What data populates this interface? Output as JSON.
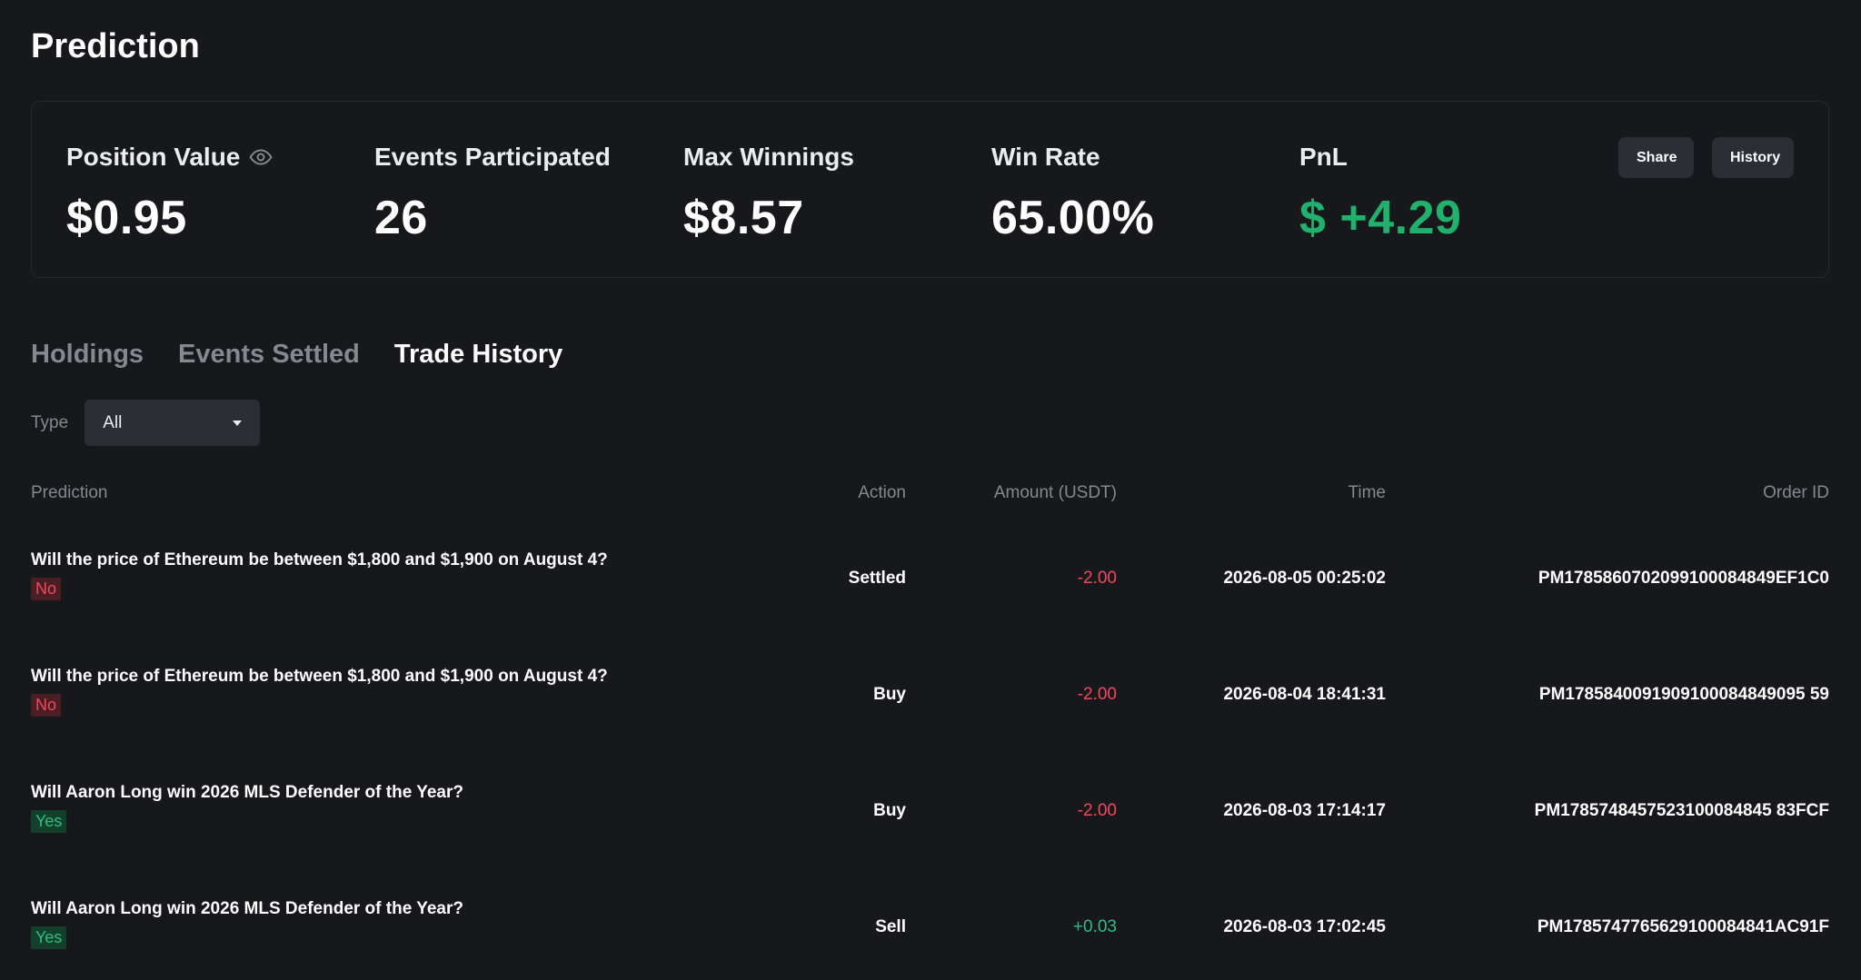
{
  "page": {
    "title": "Prediction"
  },
  "summary": {
    "position_value_label": "Position Value",
    "position_value": "$0.95",
    "events_participated_label": "Events Participated",
    "events_participated": "26",
    "max_winnings_label": "Max Winnings",
    "max_winnings": "$8.57",
    "win_rate_label": "Win Rate",
    "win_rate": "65.00%",
    "pnl_label": "PnL",
    "pnl": "$ +4.29",
    "share_label": "Share",
    "history_label": "History"
  },
  "tabs": [
    {
      "label": "Holdings",
      "active": false
    },
    {
      "label": "Events Settled",
      "active": false
    },
    {
      "label": "Trade History",
      "active": true
    }
  ],
  "filter": {
    "label": "Type",
    "selected": "All"
  },
  "table": {
    "headers": {
      "prediction": "Prediction",
      "action": "Action",
      "amount": "Amount (USDT)",
      "time": "Time",
      "order_id": "Order ID"
    },
    "rows": [
      {
        "prediction": "Will the price of Ethereum be between $1,800 and $1,900 on August 4?",
        "outcome": "No",
        "action": "Settled",
        "amount": "-2.00",
        "time": "2026-08-05 00:25:02",
        "order_id": "PM1785860702099100084849EF1C0"
      },
      {
        "prediction": "Will the price of Ethereum be between $1,800 and $1,900 on August 4?",
        "outcome": "No",
        "action": "Buy",
        "amount": "-2.00",
        "time": "2026-08-04 18:41:31",
        "order_id": "PM1785840091909100084849095 59"
      },
      {
        "prediction": "Will Aaron Long win 2026 MLS Defender of the Year?",
        "outcome": "Yes",
        "action": "Buy",
        "amount": "-2.00",
        "time": "2026-08-03 17:14:17",
        "order_id": "PM1785748457523100084845 83FCF"
      },
      {
        "prediction": "Will Aaron Long win 2026 MLS Defender of the Year?",
        "outcome": "Yes",
        "action": "Sell",
        "amount": "+0.03",
        "time": "2026-08-03 17:02:45",
        "order_id": "PM1785747765629100084841AC91F"
      }
    ]
  },
  "colors": {
    "background": "#17181c",
    "positive": "#20b26c",
    "negative": "#f6465d"
  }
}
